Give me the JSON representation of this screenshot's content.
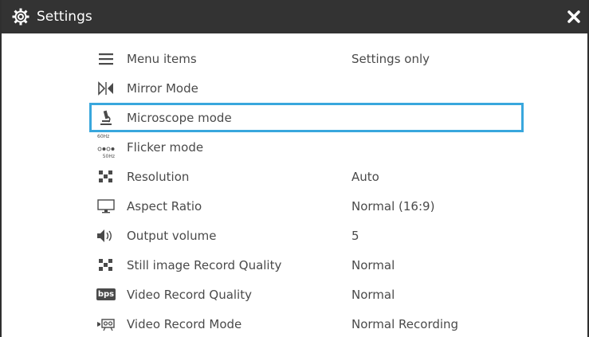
{
  "title_bar": {
    "title": "Settings",
    "icon": "gear-icon",
    "close_icon": "close-icon"
  },
  "flicker_icon_text": {
    "top": "60Hz",
    "bottom": "50Hz"
  },
  "settings": [
    {
      "icon": "menu-icon",
      "label": "Menu items",
      "value": "Settings only"
    },
    {
      "icon": "mirror-icon",
      "label": "Mirror Mode",
      "value": ""
    },
    {
      "icon": "microscope-icon",
      "label": "Microscope mode",
      "value": "",
      "selected": true
    },
    {
      "icon": "flicker-icon",
      "label": "Flicker mode",
      "value": ""
    },
    {
      "icon": "resolution-icon",
      "label": "Resolution",
      "value": "Auto"
    },
    {
      "icon": "monitor-icon",
      "label": "Aspect Ratio",
      "value": "Normal (16:9)"
    },
    {
      "icon": "speaker-icon",
      "label": "Output volume",
      "value": "5"
    },
    {
      "icon": "image-quality-icon",
      "label": "Still image Record Quality",
      "value": "Normal"
    },
    {
      "icon": "bps-icon",
      "icon_text": "bps",
      "label": "Video Record Quality",
      "value": "Normal"
    },
    {
      "icon": "video-mode-icon",
      "label": "Video Record Mode",
      "value": "Normal Recording"
    }
  ],
  "colors": {
    "title_bar": "#333333",
    "selection_border": "#39a7dd",
    "text": "#4a4a4a"
  }
}
